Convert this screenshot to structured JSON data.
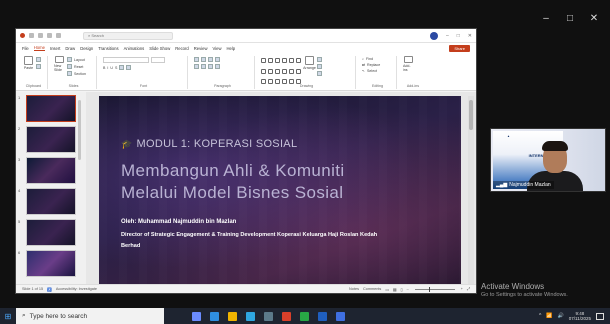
{
  "window_controls": {
    "minimize": "–",
    "maximize": "□",
    "close": "✕"
  },
  "ppt": {
    "search_placeholder": "Search",
    "menu": [
      "File",
      "Home",
      "Insert",
      "Draw",
      "Design",
      "Transitions",
      "Animations",
      "Slide Show",
      "Record",
      "Review",
      "View",
      "Help"
    ],
    "active_menu": "Home",
    "share_label": "Share",
    "ribbon_groups": [
      "Clipboard",
      "Slides",
      "Font",
      "Paragraph",
      "Drawing",
      "Editing",
      "Add-ins"
    ],
    "ribbon": {
      "paste": "Paste",
      "new_slide": "New Slide",
      "layout": "Layout",
      "reset": "Reset",
      "section": "Section",
      "arrange": "Arrange",
      "find": "Find",
      "replace": "Replace",
      "select": "Select",
      "add_ins": "Add-ins"
    },
    "slide_numbers": [
      "1",
      "2",
      "3",
      "4",
      "5",
      "6"
    ],
    "selected_slide": 1,
    "status": {
      "slide_info": "Slide 1 of 15",
      "accessibility": "Accessibility: Investigate",
      "notes": "Notes",
      "comments": "Comments"
    }
  },
  "slide": {
    "module": "MODUL 1: KOPERASI SOSIAL",
    "title_line1": "Membangun Ahli & Komuniti",
    "title_line2": "Melalui Model Bisnes Sosial",
    "presenter": "Oleh: Muhammad Najmuddin bin Mazlan",
    "affiliation_line1": "Director of Strategic Engagement & Training Development Koperasi Keluarga Haji Roslan Kedah",
    "affiliation_line2": "Berhad"
  },
  "webcam": {
    "name": "Najmuddin Mazlan",
    "banner_text": "INTERNATIONAL"
  },
  "watermark": {
    "title": "Activate Windows",
    "subtitle": "Go to Settings to activate Windows."
  },
  "taskbar": {
    "search_placeholder": "Type here to search",
    "time": "9:48",
    "date": "07/11/2025",
    "app_colors": [
      "#6b8cff",
      "#2f8fe0",
      "#f0b400",
      "#2fa7e0",
      "#5c7a8a",
      "#d9402a",
      "#28a745",
      "#1f5fbf",
      "#3f6fe0"
    ]
  }
}
